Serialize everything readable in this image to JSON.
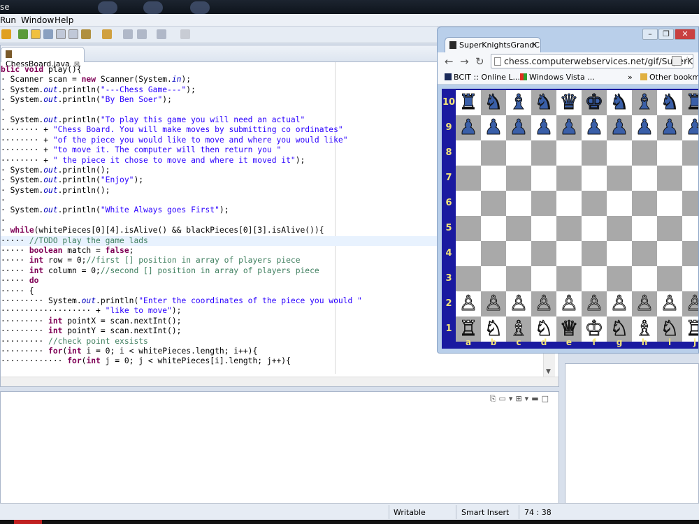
{
  "topbar": {
    "title_fragment": "se"
  },
  "menu": {
    "items": [
      "Run",
      "Window",
      "Help"
    ]
  },
  "editor": {
    "tab_label": "ChessBoard.java",
    "lines": [
      [
        [
          "kw",
          "blic void "
        ],
        [
          "",
          "play(){"
        ]
      ],
      [
        [
          "",
          "· Scanner scan = "
        ],
        [
          "kw",
          "new"
        ],
        [
          "",
          " Scanner(System."
        ],
        [
          "it",
          "in"
        ],
        [
          "",
          ");"
        ]
      ],
      [
        [
          "",
          "· System."
        ],
        [
          "it",
          "out"
        ],
        [
          "",
          ".println("
        ],
        [
          "st",
          "\"---Chess Game---\""
        ],
        [
          "",
          ");"
        ]
      ],
      [
        [
          "",
          "· System."
        ],
        [
          "it",
          "out"
        ],
        [
          "",
          ".println("
        ],
        [
          "st",
          "\"By Ben Soer\""
        ],
        [
          "",
          ");"
        ]
      ],
      [
        [
          "",
          "·"
        ]
      ],
      [
        [
          "",
          "· System."
        ],
        [
          "it",
          "out"
        ],
        [
          "",
          ".println("
        ],
        [
          "st",
          "\"To play this game you will need an actual\""
        ]
      ],
      [
        [
          "",
          "········ + "
        ],
        [
          "st",
          "\"Chess Board. You will make moves by submitting co ordinates\""
        ]
      ],
      [
        [
          "",
          "········ + "
        ],
        [
          "st",
          "\"of the piece you would like to move and where you would like\""
        ]
      ],
      [
        [
          "",
          "········ + "
        ],
        [
          "st",
          "\"to move it. The computer will then return you \""
        ]
      ],
      [
        [
          "",
          "········ + "
        ],
        [
          "st",
          "\" the piece it chose to move and where it moved it\""
        ],
        [
          "",
          ");"
        ]
      ],
      [
        [
          "",
          "· System."
        ],
        [
          "it",
          "out"
        ],
        [
          "",
          ".println();"
        ]
      ],
      [
        [
          "",
          "· System."
        ],
        [
          "it",
          "out"
        ],
        [
          "",
          ".println("
        ],
        [
          "st",
          "\"Enjoy\""
        ],
        [
          "",
          ");"
        ]
      ],
      [
        [
          "",
          "· System."
        ],
        [
          "it",
          "out"
        ],
        [
          "",
          ".println();"
        ]
      ],
      [
        [
          "",
          "·"
        ]
      ],
      [
        [
          "",
          "· System."
        ],
        [
          "it",
          "out"
        ],
        [
          "",
          ".println("
        ],
        [
          "st",
          "\"White Always goes First\""
        ],
        [
          "",
          ");"
        ]
      ],
      [
        [
          "",
          "·"
        ]
      ],
      [
        [
          "",
          "· "
        ],
        [
          "kw",
          "while"
        ],
        [
          "",
          "(whitePieces[0][4].isAlive() && blackPieces[0][3].isAlive()){"
        ]
      ],
      [
        [
          "",
          "····· "
        ],
        [
          "cm",
          "//TODO play the game lads"
        ]
      ],
      [
        [
          "",
          "····· "
        ],
        [
          "kw",
          "boolean"
        ],
        [
          "",
          " match = "
        ],
        [
          "kw",
          "false"
        ],
        [
          "",
          ";"
        ]
      ],
      [
        [
          "",
          "····· "
        ],
        [
          "kw",
          "int"
        ],
        [
          "",
          " row = 0;"
        ],
        [
          "cm",
          "//first [] position in array of players piece"
        ]
      ],
      [
        [
          "",
          "····· "
        ],
        [
          "kw",
          "int"
        ],
        [
          "",
          " column = 0;"
        ],
        [
          "cm",
          "//second [] position in array of players piece"
        ]
      ],
      [
        [
          "",
          "····· "
        ],
        [
          "kw",
          "do"
        ]
      ],
      [
        [
          "",
          "····· {"
        ]
      ],
      [
        [
          "",
          "········· System."
        ],
        [
          "it",
          "out"
        ],
        [
          "",
          ".println("
        ],
        [
          "st",
          "\"Enter the coordinates of the piece you would \""
        ]
      ],
      [
        [
          "",
          "··················· + "
        ],
        [
          "st",
          "\"like to move\""
        ],
        [
          "",
          ");"
        ]
      ],
      [
        [
          "",
          "········· "
        ],
        [
          "kw",
          "int"
        ],
        [
          "",
          " pointX = scan.nextInt();"
        ]
      ],
      [
        [
          "",
          "········· "
        ],
        [
          "kw",
          "int"
        ],
        [
          "",
          " pointY = scan.nextInt();"
        ]
      ],
      [
        [
          "",
          "········· "
        ],
        [
          "cm",
          "//check point exsists"
        ]
      ],
      [
        [
          "",
          "········· "
        ],
        [
          "kw",
          "for"
        ],
        [
          "",
          "("
        ],
        [
          "kw",
          "int"
        ],
        [
          "",
          " i = 0; i < whitePieces.length; i++){"
        ]
      ],
      [
        [
          "",
          "············· "
        ],
        [
          "kw",
          "for"
        ],
        [
          "",
          "("
        ],
        [
          "kw",
          "int"
        ],
        [
          "",
          " j = 0; j < whitePieces[i].length; j++){"
        ]
      ]
    ],
    "highlight_line": 17
  },
  "status": {
    "writable": "Writable",
    "insert_mode": "Smart Insert",
    "position": "74 : 38"
  },
  "browser": {
    "tab_title": "SuperKnightsGrandC",
    "url": "chess.computerwebservices.net/gif/SuperKn",
    "bookmarks": [
      "BCIT :: Online L...",
      "Windows Vista ...",
      "Other bookma"
    ],
    "files": [
      "a",
      "b",
      "c",
      "d",
      "e",
      "f",
      "g",
      "h",
      "i",
      "j"
    ],
    "ranks": [
      "10",
      "9",
      "8",
      "7",
      "6",
      "5",
      "4",
      "3",
      "2",
      "1"
    ],
    "position": [
      [
        "♜",
        "♞",
        "♝",
        "♞",
        "♛",
        "♚",
        "♞",
        "♝",
        "♞",
        "♜"
      ],
      [
        "♟",
        "♟",
        "♟",
        "♟",
        "♟",
        "♟",
        "♟",
        "♟",
        "♟",
        "♟"
      ],
      [
        "",
        "",
        "",
        "",
        "",
        "",
        "",
        "",
        "",
        ""
      ],
      [
        "",
        "",
        "",
        "",
        "",
        "",
        "",
        "",
        "",
        ""
      ],
      [
        "",
        "",
        "",
        "",
        "",
        "",
        "",
        "",
        "",
        ""
      ],
      [
        "",
        "",
        "",
        "",
        "",
        "",
        "",
        "",
        "",
        ""
      ],
      [
        "",
        "",
        "",
        "",
        "",
        "",
        "",
        "",
        "",
        ""
      ],
      [
        "",
        "",
        "",
        "",
        "",
        "",
        "",
        "",
        "",
        ""
      ],
      [
        "♙",
        "♙",
        "♙",
        "♙",
        "♙",
        "♙",
        "♙",
        "♙",
        "♙",
        "♙"
      ],
      [
        "♖",
        "♘",
        "♗",
        "♘",
        "♕",
        "♔",
        "♘",
        "♗",
        "♘",
        "♖"
      ]
    ]
  },
  "colors": {
    "board_border": "#1a1aa0",
    "coord_label": "#f3e47a",
    "black_piece": "#3a5fa8",
    "dark_square": "#a9a9a9"
  }
}
